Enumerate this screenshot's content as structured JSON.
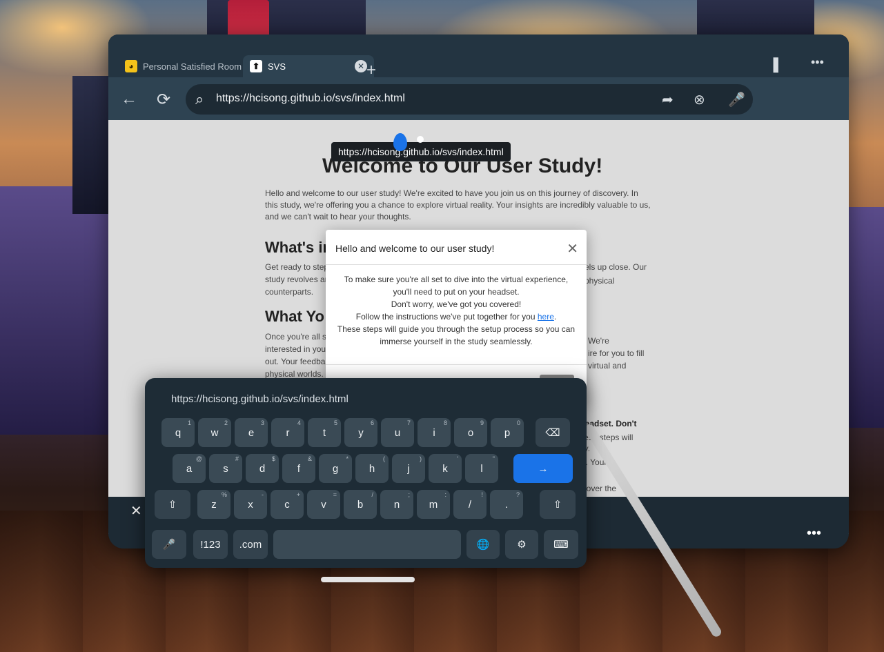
{
  "browser": {
    "tabs": [
      {
        "label": "Personal Satisfied Room",
        "active": false,
        "favicon": "dog-icon"
      },
      {
        "label": "SVS",
        "active": true,
        "favicon": "svs-icon"
      }
    ],
    "address": "https://hcisong.github.io/svs/index.html",
    "tooltip": "https://hcisong.github.io/svs/index.html"
  },
  "page": {
    "title": "Welcome to Our User Study!",
    "intro": "Hello and welcome to our user study! We're excited to have you join us on this journey of discovery. In this study, we're offering you a chance to explore virtual reality. Your insights are incredibly valuable to us, and we can't wait to hear your thoughts.",
    "section1_heading": "What's in",
    "section1_text_a": "Get ready to step",
    "section1_text_b": "study revolves ar",
    "section1_text_c": "counterparts.",
    "section1_text_right_a": "els up close. Our",
    "section1_text_right_b": "physical",
    "section2_heading": "What Yo",
    "section2_text_a": "Once you're all se",
    "section2_text_b": "interested in you",
    "section2_text_c": "out. Your feedba",
    "section2_text_d": "physical worlds.",
    "section2_text_right_a": "We're",
    "section2_text_right_b": "ire for you to fill",
    "section2_text_right_c": "virtual and",
    "section3_right_a": "ur headset. Don't",
    "section3_right_b": "These steps will",
    "section3_right_c": "ssly.",
    "section3_right_d": "tter. Your",
    "section3_right_e": "ncover the"
  },
  "modal": {
    "title": "Hello and welcome to our user study!",
    "line1": "To make sure you're all set to dive into the virtual experience,",
    "line2": "you'll need to put on your headset.",
    "line3": "Don't worry, we've got you covered!",
    "line4_prefix": "Follow the instructions we've put together for you ",
    "line4_link": "here",
    "line4_suffix": ".",
    "line5": "These steps will guide you through the setup process so you can",
    "line6": "immerse yourself in the study seamlessly."
  },
  "keyboard": {
    "url": "https://hcisong.github.io/svs/index.html",
    "row1": [
      [
        "q",
        "1"
      ],
      [
        "w",
        "2"
      ],
      [
        "e",
        "3"
      ],
      [
        "r",
        "4"
      ],
      [
        "t",
        "5"
      ],
      [
        "y",
        "6"
      ],
      [
        "u",
        "7"
      ],
      [
        "i",
        "8"
      ],
      [
        "o",
        "9"
      ],
      [
        "p",
        "0"
      ]
    ],
    "row2": [
      [
        "a",
        "@"
      ],
      [
        "s",
        "#"
      ],
      [
        "d",
        "$"
      ],
      [
        "f",
        "&"
      ],
      [
        "g",
        "*"
      ],
      [
        "h",
        "("
      ],
      [
        "j",
        ")"
      ],
      [
        "k",
        "'"
      ],
      [
        "l",
        "\""
      ]
    ],
    "row3": [
      [
        "z",
        "%"
      ],
      [
        "x",
        "-"
      ],
      [
        "c",
        "+"
      ],
      [
        "v",
        "="
      ],
      [
        "b",
        "/"
      ],
      [
        "n",
        ";"
      ],
      [
        "m",
        ":"
      ],
      [
        "/",
        "!"
      ],
      [
        ".",
        "?"
      ]
    ],
    "num_label": "!123",
    "com_label": ".com"
  },
  "icons": {
    "back": "←",
    "reload": "⟳",
    "search": "⌕",
    "share": "➦",
    "clear": "⊗",
    "mic": "🎤",
    "bookmark": "❚",
    "more": "•••",
    "close": "✕",
    "plus": "+",
    "shift": "⇧",
    "backspace": "⌫",
    "enter": "→",
    "globe": "🌐",
    "gear": "⚙",
    "keyboard": "⌨"
  }
}
